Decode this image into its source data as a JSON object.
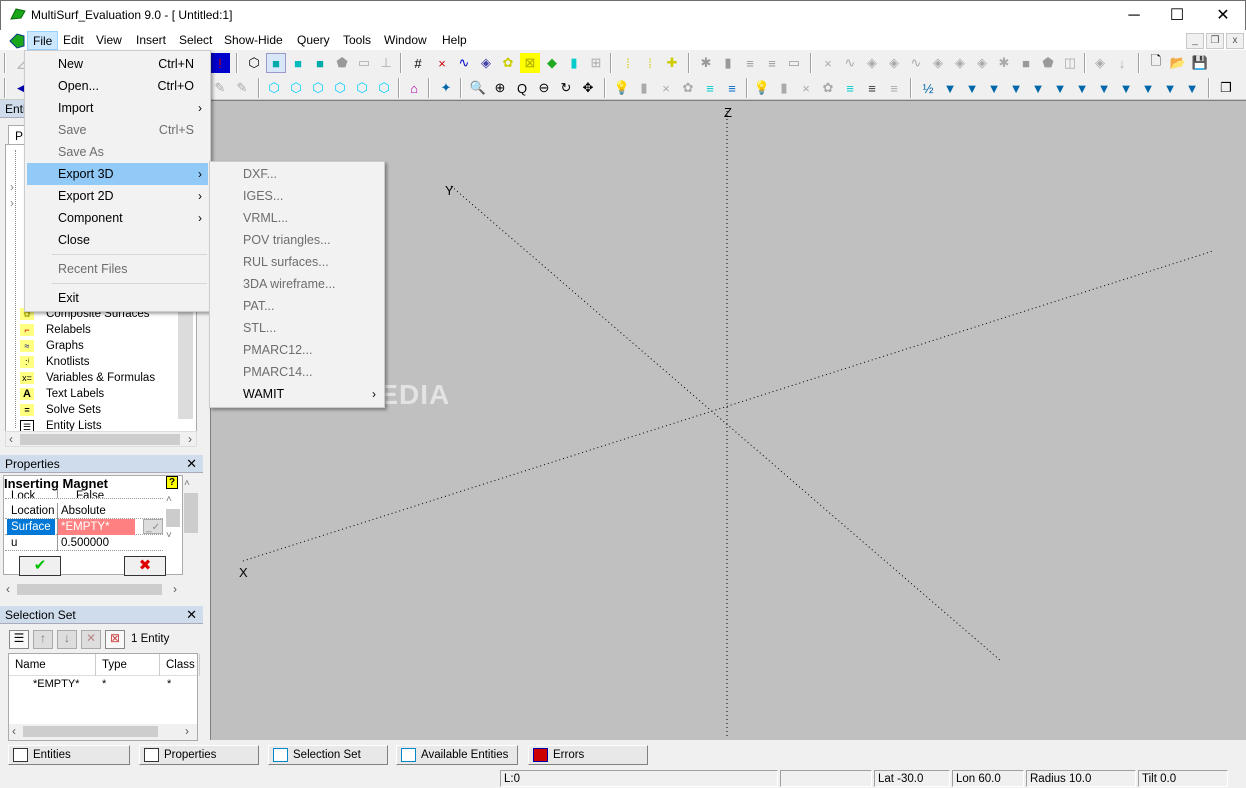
{
  "window": {
    "title": "MultiSurf_Evaluation 9.0 - [ Untitled:1]",
    "minimize": "─",
    "maximize": "☐",
    "close": "✕",
    "mdi_minimize": "_",
    "mdi_restore": "❐",
    "mdi_close": "x"
  },
  "menubar": [
    "File",
    "Edit",
    "View",
    "Insert",
    "Select",
    "Show-Hide",
    "Query",
    "Tools",
    "Window",
    "Help"
  ],
  "file_menu": {
    "items": [
      {
        "label": "New",
        "shortcut": "Ctrl+N",
        "disabled": false
      },
      {
        "label": "Open...",
        "shortcut": "Ctrl+O",
        "disabled": false
      },
      {
        "label": "Import",
        "submenu": true,
        "disabled": false
      },
      {
        "label": "Save",
        "shortcut": "Ctrl+S",
        "disabled": true
      },
      {
        "label": "Save As",
        "disabled": true
      },
      {
        "label": "Export 3D",
        "submenu": true,
        "highlighted": true
      },
      {
        "label": "Export 2D",
        "submenu": true
      },
      {
        "label": "Component",
        "submenu": true
      },
      {
        "label": "Close"
      },
      {
        "label": "Recent Files",
        "disabled": true
      },
      {
        "label": "Exit"
      }
    ]
  },
  "export3d_menu": {
    "items": [
      {
        "label": "DXF...",
        "disabled": true
      },
      {
        "label": "IGES...",
        "disabled": true
      },
      {
        "label": "VRML...",
        "disabled": true
      },
      {
        "label": "POV triangles...",
        "disabled": true
      },
      {
        "label": "RUL surfaces...",
        "disabled": true
      },
      {
        "label": "3DA wireframe...",
        "disabled": true
      },
      {
        "label": "PAT...",
        "disabled": true
      },
      {
        "label": "STL...",
        "disabled": true
      },
      {
        "label": "PMARC12...",
        "disabled": true
      },
      {
        "label": "PMARC14...",
        "disabled": true
      },
      {
        "label": "WAMIT",
        "submenu": true,
        "disabled": false
      }
    ]
  },
  "entities_panel": {
    "title": "Entities",
    "tab": "P",
    "tree_items": [
      {
        "label": "Composite Surfaces",
        "icon": "composite-surfaces-icon",
        "glyph": "✿"
      },
      {
        "label": "Relabels",
        "icon": "relabels-icon",
        "glyph": "⌐"
      },
      {
        "label": "Graphs",
        "icon": "graphs-icon",
        "glyph": "≈"
      },
      {
        "label": "Knotlists",
        "icon": "knotlists-icon",
        "glyph": ":ⁱ"
      },
      {
        "label": "Variables & Formulas",
        "icon": "variables-icon",
        "glyph": "x="
      },
      {
        "label": "Text Labels",
        "icon": "text-labels-icon",
        "glyph": "A"
      },
      {
        "label": "Solve Sets",
        "icon": "solve-sets-icon",
        "glyph": "="
      },
      {
        "label": "Entity Lists",
        "icon": "entity-lists-icon",
        "glyph": "☰"
      }
    ]
  },
  "properties_panel": {
    "title": "Properties",
    "heading": "Inserting Magnet",
    "help": "?",
    "rows": [
      {
        "key": "Lock",
        "value": "False"
      },
      {
        "key": "Location",
        "value": "Absolute"
      },
      {
        "key": "Surface",
        "value": "*EMPTY*"
      },
      {
        "key": "u",
        "value": "0.500000"
      }
    ],
    "ok_glyph": "✔",
    "cancel_glyph": "✖",
    "colors": {
      "selected_key": "#0078d7",
      "empty_value": "#ff8080",
      "ok": "#00c000",
      "cancel": "#e00000"
    }
  },
  "selection_panel": {
    "title": "Selection Set",
    "count": "1 Entity",
    "columns": [
      "Name",
      "Type",
      "Class"
    ],
    "rows": [
      {
        "name": "*EMPTY*",
        "type": "*",
        "class": "*"
      }
    ]
  },
  "dock_tabs": [
    "Entities",
    "Properties",
    "Selection Set",
    "Available Entities",
    "Errors"
  ],
  "viewport": {
    "axes": [
      "X",
      "Y",
      "Z"
    ],
    "watermark": "SOFTPEDIA"
  },
  "status": {
    "layer": "L:0",
    "empty": "",
    "lat": "Lat -30.0",
    "lon": "Lon 60.0",
    "radius": "Radius 10.0",
    "tilt": "Tilt 0.0"
  },
  "toolbar_icons": {
    "row1": [
      "wireframe-view",
      "shaded-view",
      "solid-view",
      "translucent-view",
      "render-view",
      "contour-view",
      "graph-view",
      "grid",
      "point-delete",
      "curve-delete",
      "surface-delete",
      "composite-delete",
      "cross-delete",
      "mesh-delete",
      "line-delete",
      "box",
      "point-add",
      "point-add2",
      "snap",
      "entity-hide",
      "list-show",
      "list-show2",
      "list-show3",
      "list-select",
      "x-dim",
      "curve",
      "surface",
      "surface2",
      "curve2",
      "surface3",
      "surface4",
      "surface5",
      "mesh",
      "solid-gray",
      "solid-gray2",
      "composite",
      "layer",
      "arrow-down",
      "new-file",
      "open-file",
      "save-file"
    ],
    "row2": [
      "view-front",
      "view-top",
      "view-side",
      "view-iso",
      "view-iso2",
      "view-iso3",
      "home",
      "pick",
      "zoom-window",
      "zoom-in",
      "zoom-fit",
      "zoom-out",
      "rotate",
      "pan",
      "light-on",
      "light-off",
      "light-x",
      "light-group",
      "light-list",
      "light-list2",
      "bulb",
      "bulb2",
      "bulb3",
      "bulb4",
      "bulb5",
      "bulb6",
      "filter-half",
      "filter-point",
      "filter-curve",
      "filter-surface",
      "filter-surface2",
      "filter-solid",
      "filter-composite",
      "filter-mesh",
      "filter-green",
      "filter-axis",
      "filter-graph",
      "filter-dots",
      "filter-dots2",
      "cascade"
    ]
  }
}
